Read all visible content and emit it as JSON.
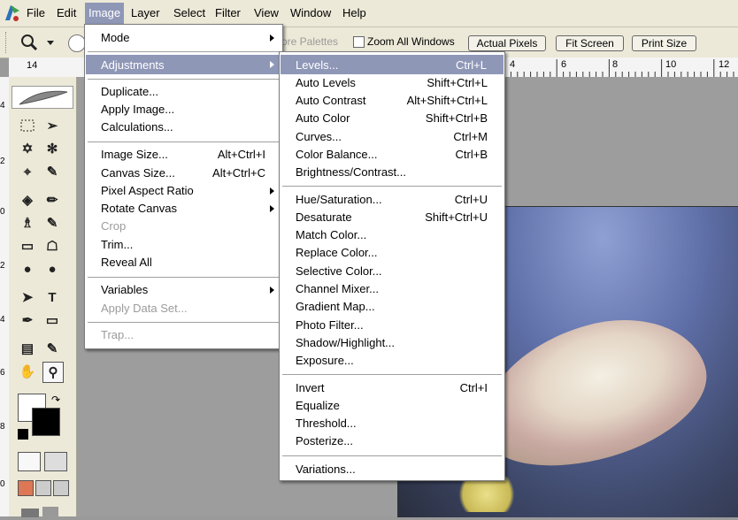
{
  "menubar": {
    "items": [
      "File",
      "Edit",
      "Image",
      "Layer",
      "Select",
      "Filter",
      "View",
      "Window",
      "Help"
    ],
    "active": "Image"
  },
  "options_bar": {
    "partial_text": "ore Palettes",
    "zoom_all_label": "Zoom All Windows",
    "actual_pixels_label": "Actual Pixels",
    "fit_screen_label": "Fit Screen",
    "print_size_label": "Print Size"
  },
  "ruler": {
    "corner_label": "14",
    "ticks": [
      "4",
      "6",
      "8",
      "10",
      "12"
    ]
  },
  "vertical_ruler": {
    "ticks": [
      "4",
      "2",
      "0",
      "2",
      "4",
      "6",
      "8",
      "0"
    ]
  },
  "image_menu": {
    "items": [
      {
        "label": "Mode",
        "submenu": true
      },
      {
        "label": "Adjustments",
        "submenu": true,
        "highlighted": true
      },
      {
        "label": "Duplicate..."
      },
      {
        "label": "Apply Image..."
      },
      {
        "label": "Calculations..."
      },
      {
        "label": "Image Size...",
        "shortcut": "Alt+Ctrl+I"
      },
      {
        "label": "Canvas Size...",
        "shortcut": "Alt+Ctrl+C"
      },
      {
        "label": "Pixel Aspect Ratio",
        "submenu": true
      },
      {
        "label": "Rotate Canvas",
        "submenu": true
      },
      {
        "label": "Crop",
        "disabled": true
      },
      {
        "label": "Trim..."
      },
      {
        "label": "Reveal All"
      },
      {
        "label": "Variables",
        "submenu": true
      },
      {
        "label": "Apply Data Set...",
        "disabled": true
      },
      {
        "label": "Trap...",
        "disabled": true
      }
    ]
  },
  "adjustments_menu": {
    "items": [
      {
        "label": "Levels...",
        "shortcut": "Ctrl+L",
        "highlighted": true
      },
      {
        "label": "Auto Levels",
        "shortcut": "Shift+Ctrl+L"
      },
      {
        "label": "Auto Contrast",
        "shortcut": "Alt+Shift+Ctrl+L"
      },
      {
        "label": "Auto Color",
        "shortcut": "Shift+Ctrl+B"
      },
      {
        "label": "Curves...",
        "shortcut": "Ctrl+M"
      },
      {
        "label": "Color Balance...",
        "shortcut": "Ctrl+B"
      },
      {
        "label": "Brightness/Contrast..."
      },
      {
        "label": "Hue/Saturation...",
        "shortcut": "Ctrl+U"
      },
      {
        "label": "Desaturate",
        "shortcut": "Shift+Ctrl+U"
      },
      {
        "label": "Match Color..."
      },
      {
        "label": "Replace Color..."
      },
      {
        "label": "Selective Color..."
      },
      {
        "label": "Channel Mixer..."
      },
      {
        "label": "Gradient Map..."
      },
      {
        "label": "Photo Filter..."
      },
      {
        "label": "Shadow/Highlight..."
      },
      {
        "label": "Exposure..."
      },
      {
        "label": "Invert",
        "shortcut": "Ctrl+I"
      },
      {
        "label": "Equalize"
      },
      {
        "label": "Threshold..."
      },
      {
        "label": "Posterize..."
      },
      {
        "label": "Variations..."
      }
    ]
  },
  "colors": {
    "menu_highlight": "#8f97b7",
    "chrome": "#ece9d8"
  }
}
